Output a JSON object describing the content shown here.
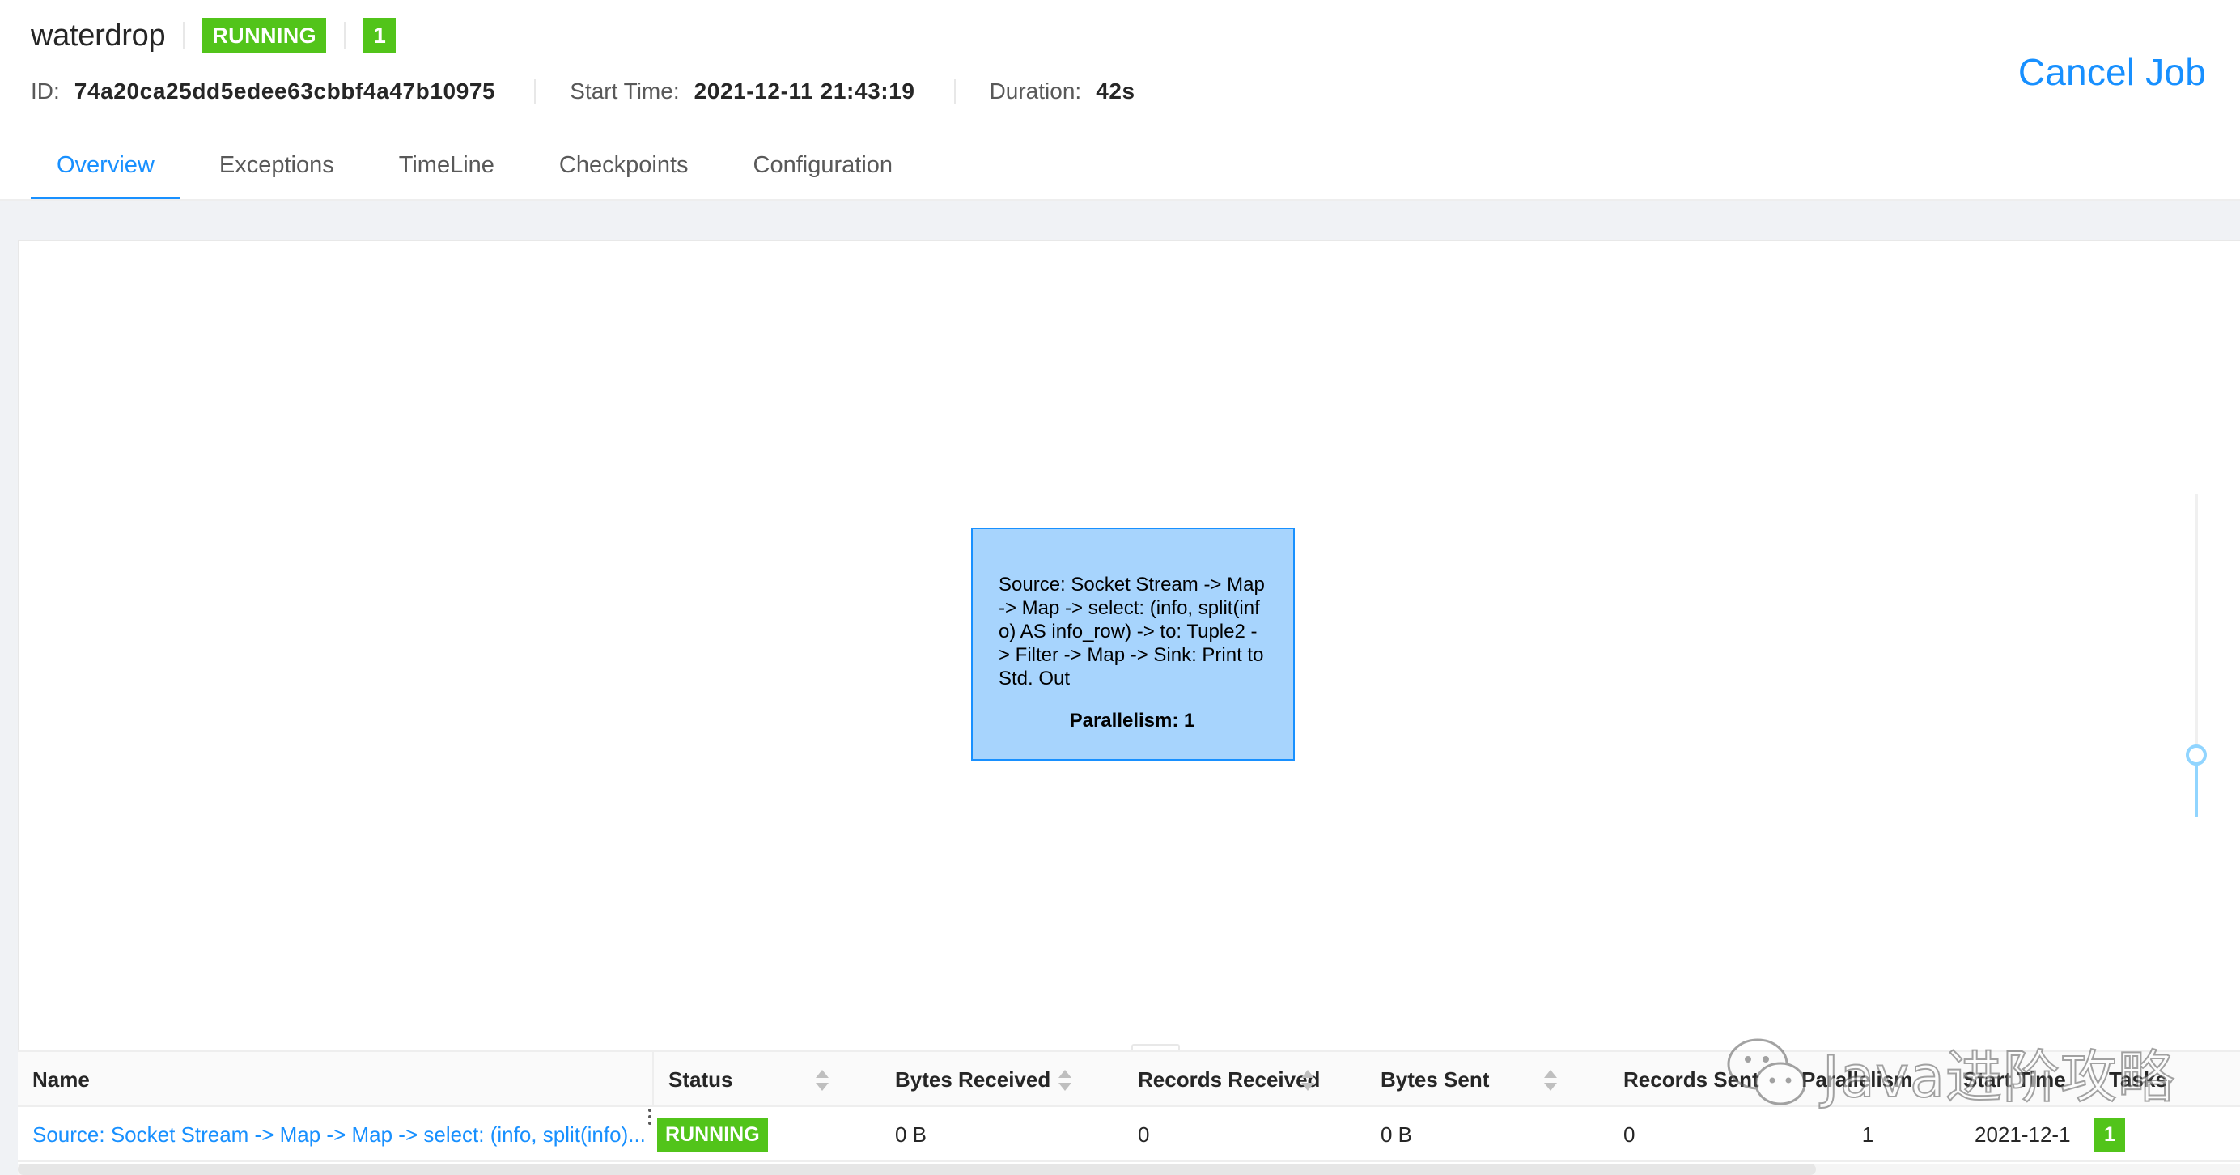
{
  "job": {
    "name": "waterdrop",
    "status": "RUNNING",
    "task_count": "1",
    "id_label": "ID:",
    "id": "74a20ca25dd5edee63cbbf4a47b10975",
    "start_time_label": "Start Time:",
    "start_time": "2021-12-11 21:43:19",
    "duration_label": "Duration:",
    "duration": "42s",
    "cancel_label": "Cancel Job"
  },
  "tabs": [
    {
      "label": "Overview",
      "active": true
    },
    {
      "label": "Exceptions",
      "active": false
    },
    {
      "label": "TimeLine",
      "active": false
    },
    {
      "label": "Checkpoints",
      "active": false
    },
    {
      "label": "Configuration",
      "active": false
    }
  ],
  "graph": {
    "node": {
      "text": "Source: Socket Stream -> Map -> Map -> select: (info, split(info) AS info_row) -> to: Tuple2 -> Filter -> Map -> Sink: Print to Std. Out",
      "parallelism": "Parallelism: 1"
    },
    "zoom_level": 0.19
  },
  "resize_handle": "...",
  "table": {
    "headers": {
      "name": "Name",
      "status": "Status",
      "bytes_received": "Bytes Received",
      "records_received": "Records Received",
      "bytes_sent": "Bytes Sent",
      "records_sent": "Records Sent",
      "parallelism": "Parallelism",
      "start_time": "Start Time",
      "tasks": "Tasks"
    },
    "rows": [
      {
        "name": "Source: Socket Stream -> Map -> Map -> select: (info, split(info)...",
        "status": "RUNNING",
        "bytes_received": "0 B",
        "records_received": "0",
        "bytes_sent": "0 B",
        "records_sent": "0",
        "parallelism": "1",
        "start_time": "2021-12-1",
        "tasks": "1"
      }
    ]
  },
  "watermark": {
    "text": "Java进阶攻略",
    "icon": "wechat-icon"
  },
  "colors": {
    "primary": "#1890ff",
    "running": "#52c41a",
    "node_fill": "#a7d4fd",
    "background": "#f0f2f5"
  }
}
